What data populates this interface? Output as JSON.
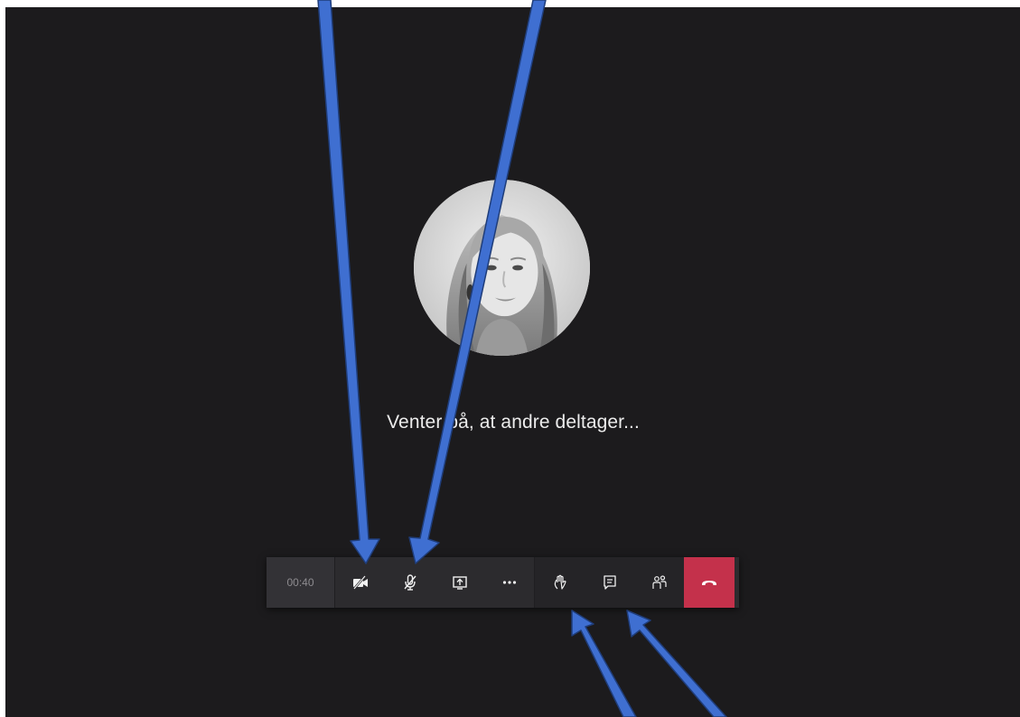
{
  "call": {
    "waiting_text": "Venter på, at andre deltager...",
    "timer": "00:40"
  },
  "toolbar": {
    "buttons": [
      {
        "name": "camera-off-button",
        "icon": "camera-off-icon"
      },
      {
        "name": "mic-muted-button",
        "icon": "mic-off-icon"
      },
      {
        "name": "share-screen-button",
        "icon": "share-screen-icon"
      },
      {
        "name": "more-actions-button",
        "icon": "more-icon"
      },
      {
        "name": "raise-hand-button",
        "icon": "raise-hand-icon"
      },
      {
        "name": "chat-button",
        "icon": "chat-icon"
      },
      {
        "name": "participants-button",
        "icon": "people-icon"
      },
      {
        "name": "hang-up-button",
        "icon": "hang-up-icon"
      }
    ]
  },
  "colors": {
    "background": "#1c1b1d",
    "toolbar": "#2c2b2e",
    "hangup": "#c4314b",
    "annotation_arrow": "#3f6fd1"
  }
}
